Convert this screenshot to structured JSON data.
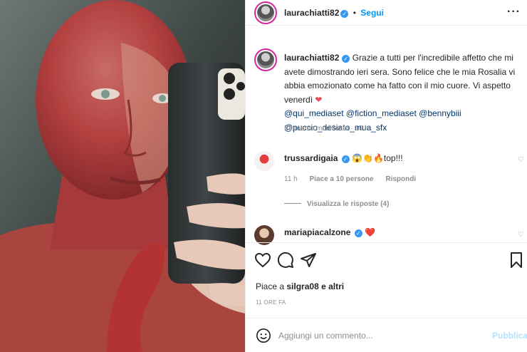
{
  "post": {
    "author": {
      "username": "laurachiatti82",
      "verified_icon": "verified-badge-icon",
      "follow_label": "Segui",
      "more_icon": "more-options-icon"
    },
    "caption": {
      "username": "laurachiatti82",
      "text": "Grazie a tutti per l'incredibile affetto che mi avete dimostrando ieri sera. Sono felice che le mia Rosalia vi abbia emozionato come ha fatto con il mio cuore. Vi aspetto venerdì",
      "mentions": [
        "@qui_mediaset",
        "@fiction_mediaset",
        "@bennybiii",
        "@puccio_desiato_mua_sfx"
      ],
      "edited": "Elemento modificato",
      "time": "10 h"
    },
    "comments": [
      {
        "username": "trussardigaia",
        "text": "😱👏🔥top!!!",
        "time": "11 h",
        "likes": "Piace a 10 persone",
        "reply": "Rispondi",
        "view_replies": "Visualizza le risposte (4)"
      },
      {
        "username": "mariapiacalzone",
        "text": "❤️"
      }
    ],
    "liked_by": {
      "prefix": "Piace a",
      "user": "silgra08",
      "suffix": "e altri"
    },
    "posted_time": "11 ORE FA",
    "add_comment": {
      "placeholder": "Aggiungi un commento...",
      "publish_label": "Pubblica"
    },
    "colors": {
      "accent": "#0095f6",
      "heart": "#ed4956",
      "mention": "#00376b"
    }
  }
}
